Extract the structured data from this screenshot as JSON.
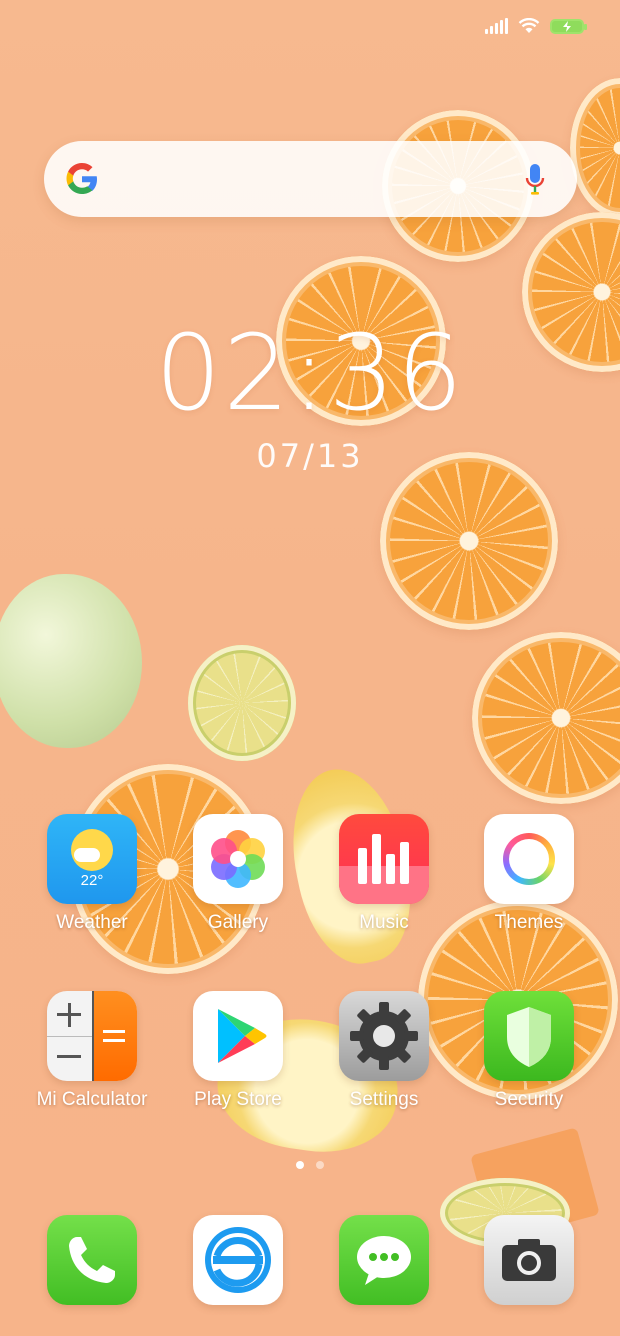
{
  "status_bar": {
    "battery_state": "charging"
  },
  "search_bar": {
    "logo": "google-logo",
    "mic_icon": "mic-icon"
  },
  "clock": {
    "time": "02:36",
    "date": "07/13"
  },
  "apps": [
    {
      "name": "Weather",
      "icon": "weather-icon",
      "temp": "22°"
    },
    {
      "name": "Gallery",
      "icon": "gallery-icon"
    },
    {
      "name": "Music",
      "icon": "music-icon"
    },
    {
      "name": "Themes",
      "icon": "themes-icon"
    },
    {
      "name": "Mi Calculator",
      "icon": "calculator-icon"
    },
    {
      "name": "Play Store",
      "icon": "play-store-icon"
    },
    {
      "name": "Settings",
      "icon": "settings-icon"
    },
    {
      "name": "Security",
      "icon": "security-icon"
    }
  ],
  "page_indicator": {
    "pages": 2,
    "current": 1
  },
  "dock": [
    {
      "icon": "phone-icon"
    },
    {
      "icon": "browser-icon"
    },
    {
      "icon": "messages-icon"
    },
    {
      "icon": "camera-icon"
    }
  ],
  "colors": {
    "wallpaper": "#f7b98f",
    "accent_green": "#5fcf2f"
  }
}
